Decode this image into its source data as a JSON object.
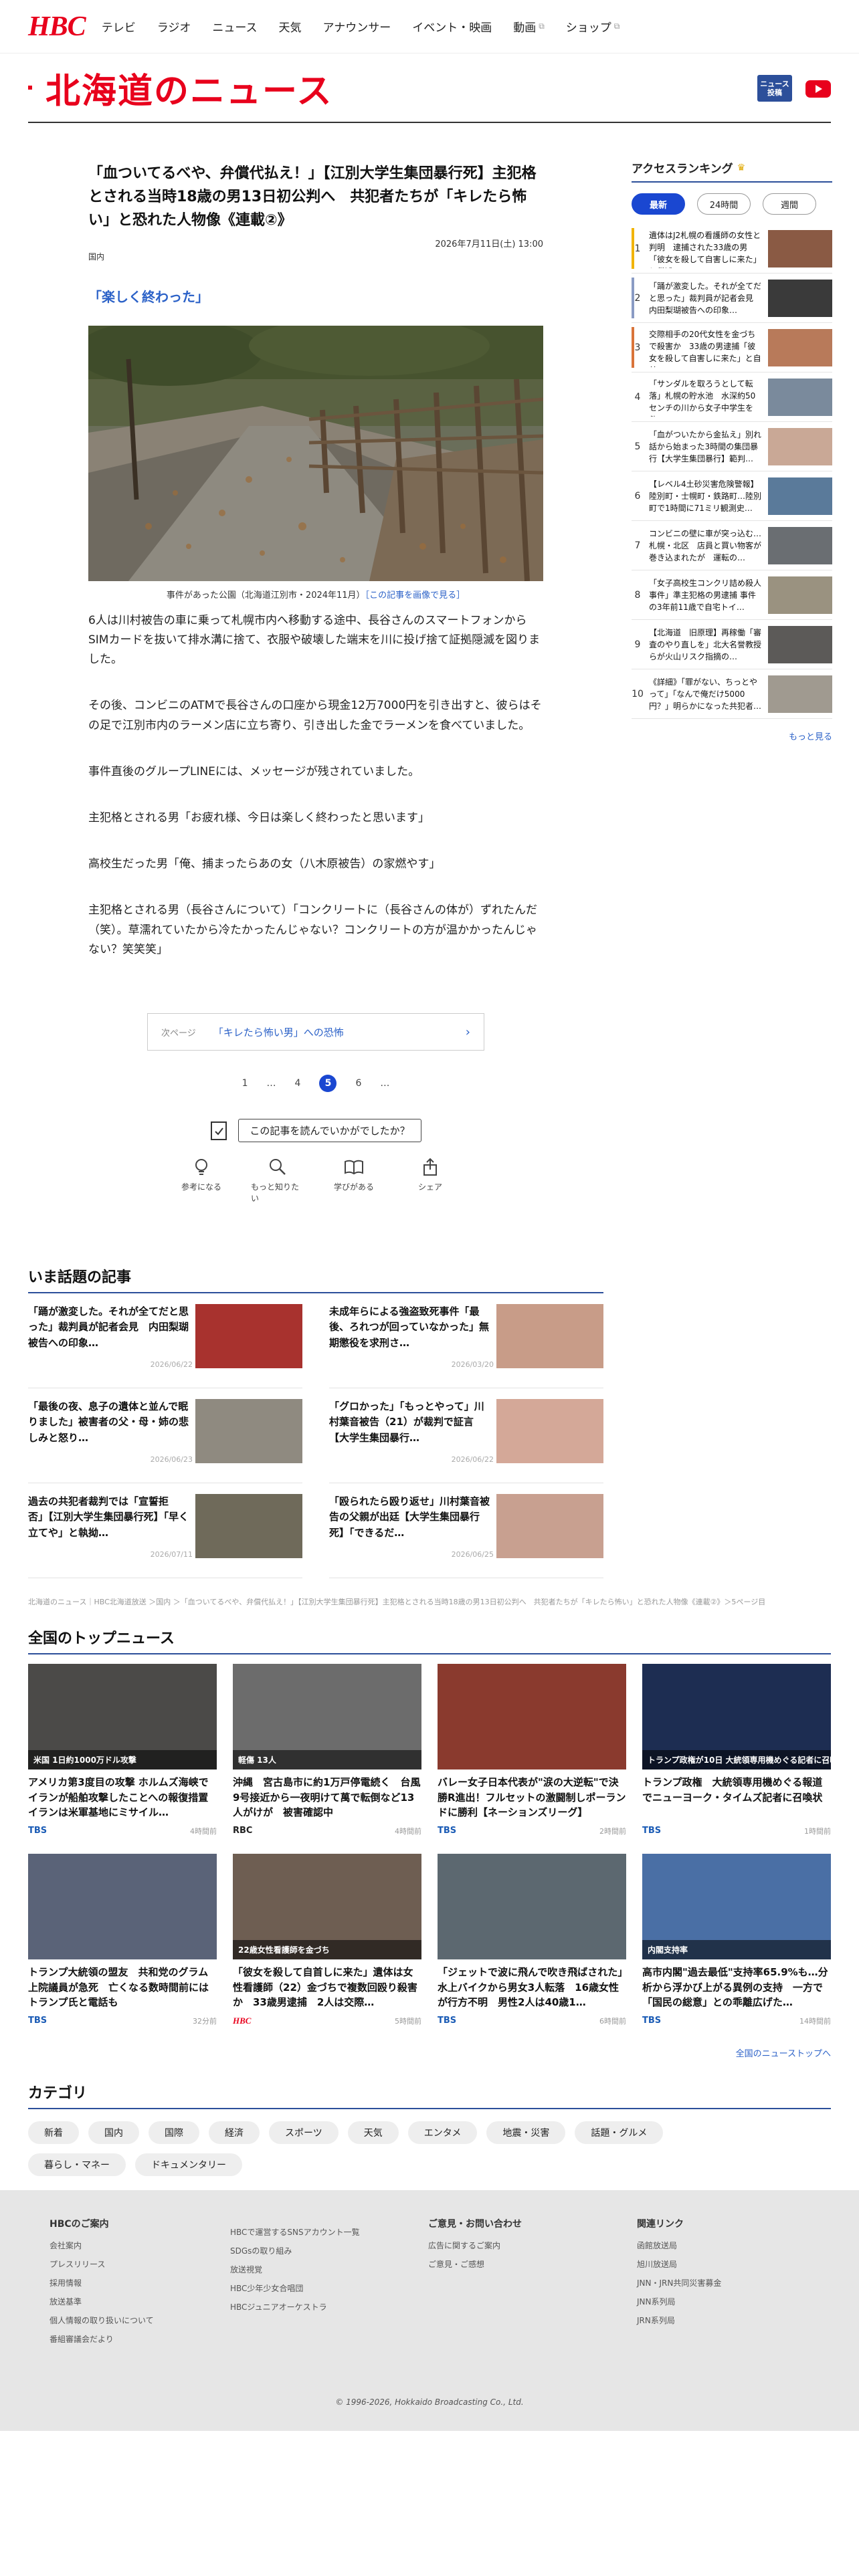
{
  "nav": {
    "logo": "HBC",
    "items": [
      "テレビ",
      "ラジオ",
      "ニュース",
      "天気",
      "アナウンサー",
      "イベント・映画",
      "動画",
      "ショップ"
    ]
  },
  "banner": {
    "title": "北海道のニュース",
    "post_label": "ニュース投稿"
  },
  "article": {
    "title": "「血ついてるべや、弁償代払え！」【江別大学生集団暴行死】主犯格とされる当時18歳の男13日初公判へ　共犯者たちが「キレたら怖い」と恐れた人物像《連載②》",
    "date": "2026年7月11日(土) 13:00",
    "category": "国内",
    "subheading": "「楽しく終わった」",
    "caption": "事件があった公園（北海道江別市・2024年11月）",
    "caption_link": "［この記事を画像で見る］",
    "paragraphs": [
      "6人は川村被告の車に乗って札幌市内へ移動する途中、長谷さんのスマートフォンからSIMカードを抜いて排水溝に捨て、衣服や破壊した端末を川に投げ捨て証拠隠滅を図りました。",
      "その後、コンビニのATMで長谷さんの口座から現金12万7000円を引き出すと、彼らはその足で江別市内のラーメン店に立ち寄り、引き出した金でラーメンを食べていました。",
      "事件直後のグループLINEには、メッセージが残されていました。",
      "主犯格とされる男「お疲れ様、今日は楽しく終わったと思います」",
      "高校生だった男「俺、捕まったらあの女（八木原被告）の家燃やす」",
      "主犯格とされる男（長谷さんについて）「コンクリートに（長谷さんの体が）ずれたんだ（笑）。草濡れていたから冷たかったんじゃない？コンクリートの方が温かかったんじゃない？笑笑笑」"
    ],
    "next_label": "次ページ",
    "next_title": "「キレたら怖い男」への恐怖",
    "pages": [
      "1",
      "…",
      "4",
      "5",
      "6",
      "…"
    ],
    "feedback_q": "この記事を読んでいかがでしたか？",
    "reactions": [
      "参考になる",
      "もっと知りたい",
      "学びがある",
      "シェア"
    ]
  },
  "ranking": {
    "title": "アクセスランキング",
    "tabs": [
      "最新",
      "24時間",
      "週間"
    ],
    "items": [
      {
        "n": "1",
        "t": "遺体はJ2札幌の看護師の女性と判明　逮捕された33歳の男「彼女を殺して自害しに来た」と供述…",
        "bar": "#f1b400"
      },
      {
        "n": "2",
        "t": "「踊が激変した。それが全てだと思った」裁判員が記者会見　内田梨瑚被告への印象…",
        "bar": "#8a9bc4"
      },
      {
        "n": "3",
        "t": "交際相手の20代女性を金づちで殺害か　33歳の男逮捕「彼女を殺して自害しに来た」と自首…",
        "bar": "#d9743a"
      },
      {
        "n": "4",
        "t": "「サンダルを取ろうとして転落」札幌の貯水池　水深約50センチの川から女子中学生を救…",
        "bar": ""
      },
      {
        "n": "5",
        "t": "「血がついたから金払え」別れ話から始まった3時間の集団暴行【大学生集団暴行】範判…",
        "bar": ""
      },
      {
        "n": "6",
        "t": "【レベル4土砂災害危険警報】陸別町・士幌町・鉄路町…陸別町で1時間に71ミリ観測史…",
        "bar": ""
      },
      {
        "n": "7",
        "t": "コンビニの壁に車が突っ込む…札幌・北区　店員と買い物客が巻き込まれたが　運転の…",
        "bar": ""
      },
      {
        "n": "8",
        "t": "「女子高校生コンクリ詰め殺人事件」準主犯格の男逮捕 事件の3年前11歳で自宅トイ…",
        "bar": ""
      },
      {
        "n": "9",
        "t": "【北海道　旧原理】再稼働「審査のやり直しを」北大名誉教授らが火山リスク指摘の…",
        "bar": ""
      },
      {
        "n": "10",
        "t": "《詳細》「罪がない、ちっとやって」「なんで俺だけ5000円？」明らかになった共犯者…",
        "bar": ""
      }
    ],
    "more": "もっと見る"
  },
  "hot": {
    "title": "いま話題の記事",
    "items": [
      {
        "t": "「踊が激変した。それが全てだと思った」裁判員が記者会見　内田梨瑚被告への印象…",
        "d": "2026/06/22"
      },
      {
        "t": "未成年らによる強盗致死事件「最後、ろれつが回っていなかった」無期懲役を求刑さ…",
        "d": "2026/03/20"
      },
      {
        "t": "「最後の夜、息子の遺体と並んで眠りました」被害者の父・母・姉の悲しみと怒り…",
        "d": "2026/06/23"
      },
      {
        "t": "「グロかった」「もっとやって」川村葉音被告（21）が裁判で証言【大学生集団暴行…",
        "d": "2026/06/22"
      },
      {
        "t": "過去の共犯者裁判では「宣誓拒否」【江別大学生集団暴行死】「早く立てや」と執拗…",
        "d": "2026/07/11"
      },
      {
        "t": "「殴られたら殴り返せ」川村葉音被告の父親が出廷【大学生集団暴行死】「できるだ…",
        "d": "2026/06/25"
      }
    ]
  },
  "breadcrumb": "北海道のニュース｜HBC北海道放送 ＞国内 ＞「血ついてるべや、弁償代払え！」【江別大学生集団暴行死】主犯格とされる当時18歳の男13日初公判へ　共犯者たちが「キレたら怖い」と恐れた人物像《連載②》＞5ページ目",
  "top": {
    "title": "全国のトップニュース",
    "items": [
      {
        "t": "アメリカ第3度目の攻撃 ホルムズ海峡でイランが船舶攻撃したことへの報復措置　イランは米軍基地にミサイル…",
        "src": "TBS",
        "d": "4時間前",
        "overlay": "米国 1日約1000万ドル攻撃",
        "bg": "#4b4a48"
      },
      {
        "t": "沖縄　宮古島市に約1万戸停電続く　台風9号接近から一夜明けて萬で転倒など13人がけが　被害確認中",
        "src": "RBC",
        "d": "4時間前",
        "overlay": "軽傷 13人",
        "bg": "#6c6c6c"
      },
      {
        "t": "バレー女子日本代表が\"涙の大逆転\"で決勝R進出！フルセットの激闘制しポーランドに勝利【ネーションズリーグ】",
        "src": "TBS",
        "d": "2時間前",
        "overlay": "",
        "bg": "#8a3a2e"
      },
      {
        "t": "トランプ政権　大統領専用機めぐる報道でニューヨーク・タイムズ記者に召喚状",
        "src": "TBS",
        "d": "1時間前",
        "overlay": "トランプ政権が10日 大統領専用機めぐる記者に召喚状",
        "bg": "#1d2d52"
      },
      {
        "t": "トランプ大統領の盟友　共和党のグラム上院議員が急死　亡くなる数時間前にはトランプ氏と電話も",
        "src": "TBS",
        "d": "32分前",
        "overlay": "",
        "bg": "#5a6378"
      },
      {
        "t": "「彼女を殺して自首しに来た」遺体は女性看護師（22）金づちで複数回殴り殺害か　33歳男逮捕　2人は交際…",
        "src": "HBC",
        "d": "5時間前",
        "overlay": "22歳女性看護師を金づち",
        "bg": "#6e5e52"
      },
      {
        "t": "「ジェットで波に飛んで吹き飛ばされた」水上バイクから男女3人転落　16歳女性が行方不明　男性2人は40歳1…",
        "src": "TBS",
        "d": "6時間前",
        "overlay": "",
        "bg": "#5c6870"
      },
      {
        "t": "高市内閣\"過去最低\"支持率65.9%も…分析から浮かび上がる異例の支持　一方で「国民の総意」との乖離広げた…",
        "src": "TBS",
        "d": "14時間前",
        "overlay": "内閣支持率",
        "bg": "#4a6fa5"
      }
    ],
    "more": "全国のニューストップへ"
  },
  "categories": {
    "title": "カテゴリ",
    "items": [
      "新着",
      "国内",
      "国際",
      "経済",
      "スポーツ",
      "天気",
      "エンタメ",
      "地震・災害",
      "話題・グルメ",
      "暮らし・マネー",
      "ドキュメンタリー"
    ]
  },
  "footer": {
    "cols": [
      {
        "h": "HBCのご案内",
        "items": [
          "会社案内",
          "プレスリリース",
          "採用情報",
          "放送基準",
          "個人情報の取り扱いについて",
          "番組審議会だより"
        ]
      },
      {
        "h": "",
        "items": [
          "HBCで運営するSNSアカウント一覧",
          "SDGsの取り組み",
          "放送視覚",
          "HBC少年少女合唱団",
          "HBCジュニアオーケストラ"
        ]
      },
      {
        "h": "ご意見・お問い合わせ",
        "items": [
          "広告に関するご案内",
          "ご意見・ご感想"
        ]
      },
      {
        "h": "関連リンク",
        "items": [
          "函館放送局",
          "旭川放送局",
          "JNN・JRN共同災害募金",
          "JNN系列局",
          "JRN系列局"
        ]
      }
    ],
    "copyright": "© 1996-2026, Hokkaido Broadcasting Co., Ltd."
  },
  "colors": {
    "brand_red": "#e8001c",
    "accent_blue": "#1a47d1",
    "link_blue": "#2c62c8",
    "rule_blue": "#2c4f9a"
  }
}
